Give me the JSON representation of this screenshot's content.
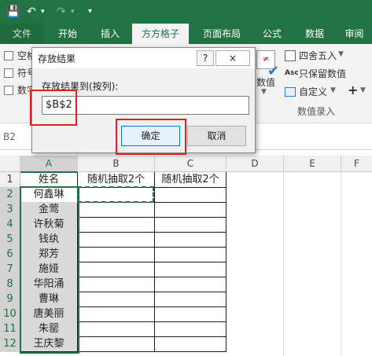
{
  "quick_access": {
    "save": "save-icon",
    "undo": "undo-icon",
    "redo": "redo-icon"
  },
  "tabs": [
    "文件",
    "开始",
    "插入",
    "方方格子",
    "页面布局",
    "公式",
    "数据",
    "审阅"
  ],
  "ribbon": {
    "left_labels": [
      "空格",
      "符号",
      "数字"
    ],
    "right_items": [
      "四舍五入",
      "只保留数值",
      "自定义"
    ],
    "value_label": "数值",
    "group_label": "数值录入",
    "plus": "+",
    "arrow": "▼"
  },
  "name_box": "B2",
  "columns": [
    "A",
    "B",
    "C",
    "D",
    "E",
    "F"
  ],
  "rows": [
    "1",
    "2",
    "3",
    "4",
    "5",
    "6",
    "7",
    "8",
    "9",
    "10",
    "11",
    "12"
  ],
  "cells": {
    "A1": "姓名",
    "B1": "随机抽取2个",
    "C1": "随机抽取2个",
    "A": [
      "何鑫琳",
      "金莺",
      "许秋菊",
      "钱纨",
      "郑芳",
      "施娅",
      "华阳涌",
      "曹琳",
      "唐美丽",
      "朱罂",
      "王庆黎"
    ]
  },
  "dialog": {
    "title": "存放结果",
    "help": "?",
    "close": "×",
    "label": "存放结果到(按列):",
    "value": "$B$2",
    "ok": "确定",
    "cancel": "取消"
  },
  "colors": {
    "excel_green": "#217346",
    "highlight_red": "#e02020",
    "gray_cell": "#d9d9d9"
  }
}
